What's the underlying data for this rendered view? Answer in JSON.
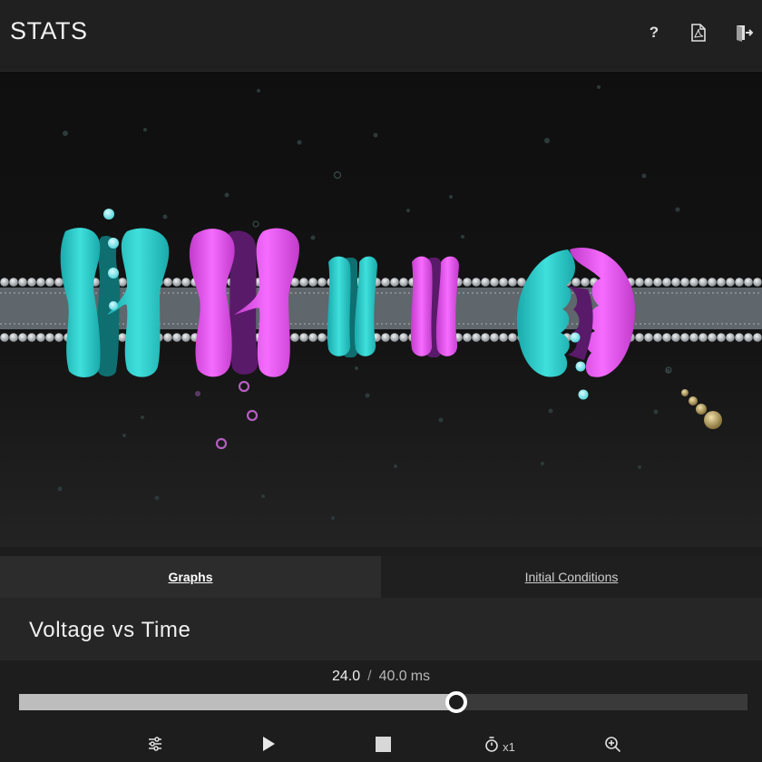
{
  "header": {
    "title": "STATS",
    "icons": [
      "help-icon",
      "pdf-icon",
      "exit-icon"
    ]
  },
  "scene": {
    "colors": {
      "channel_cyan": "#22c9c9",
      "channel_magenta": "#e34bec",
      "ion_cyan": "#7be6ec",
      "ion_magenta": "#c86ad4",
      "molecule_gold": "#bfa86a",
      "membrane": "#8a9096"
    }
  },
  "tabs": [
    {
      "label": "Graphs",
      "active": true
    },
    {
      "label": "Initial Conditions",
      "active": false
    }
  ],
  "panel": {
    "title": "Voltage vs Time"
  },
  "playback": {
    "current": "24.0",
    "separator": "/",
    "total": "40.0",
    "unit": "ms",
    "progress": 0.6,
    "speed_label": "x1"
  },
  "controls": {
    "icons": [
      "settings-sliders-icon",
      "play-icon",
      "stop-icon",
      "timer-icon",
      "zoom-in-icon"
    ]
  }
}
